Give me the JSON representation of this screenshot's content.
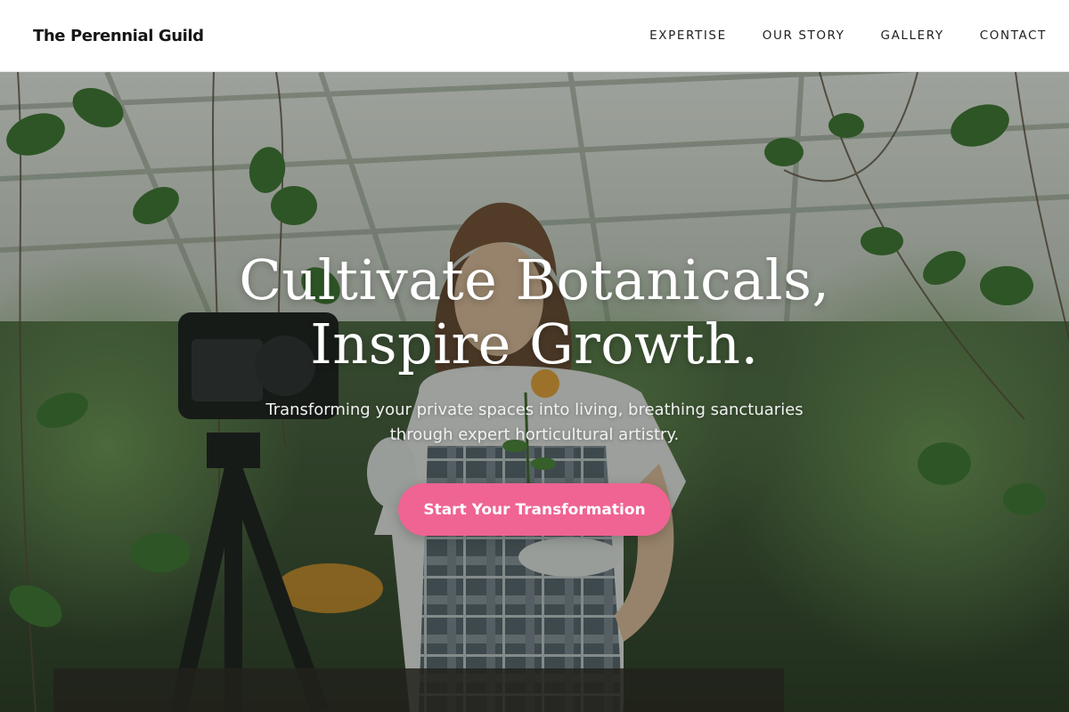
{
  "brand": {
    "name": "The Perennial Guild"
  },
  "nav": {
    "items": [
      {
        "label": "EXPERTISE"
      },
      {
        "label": "OUR STORY"
      },
      {
        "label": "GALLERY"
      },
      {
        "label": "CONTACT"
      }
    ]
  },
  "hero": {
    "title_line1": "Cultivate Botanicals,",
    "title_line2": "Inspire Growth.",
    "subtitle_line1": "Transforming your private spaces into living, breathing sanctuaries",
    "subtitle_line2": "through expert horticultural artistry.",
    "cta_label": "Start Your Transformation",
    "background_icon": "greenhouse-photo"
  },
  "colors": {
    "cta": "#ef6492",
    "nav_background": "#ffffff",
    "text_dark": "#161616",
    "hero_text": "#ffffff"
  }
}
